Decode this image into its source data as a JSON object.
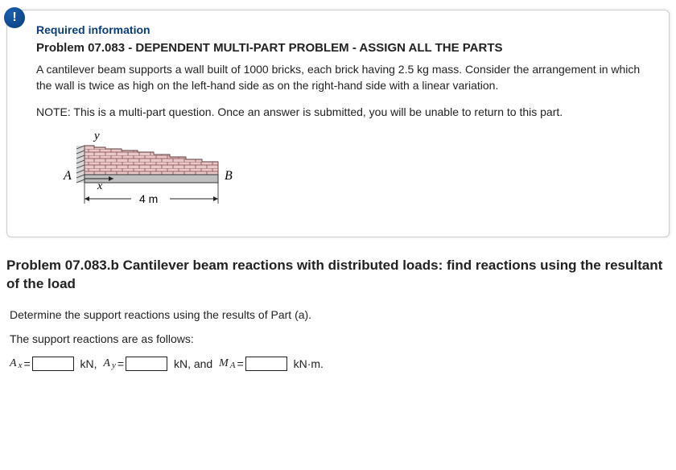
{
  "badge": "!",
  "info": {
    "required_label": "Required information",
    "header": "Problem 07.083 - DEPENDENT MULTI-PART PROBLEM - ASSIGN ALL THE PARTS",
    "description": "A cantilever beam supports a wall built of 1000 bricks, each brick having 2.5 kg mass. Consider the arrangement in which the wall is twice as high on the left-hand side as on the right-hand side with a linear variation.",
    "note": "NOTE: This is a multi-part question. Once an answer is submitted, you will be unable to return to this part.",
    "figure": {
      "y": "y",
      "x": "x",
      "A": "A",
      "B": "B",
      "length": "4 m"
    }
  },
  "sub": {
    "header": "Problem 07.083.b Cantilever beam reactions with distributed loads: find reactions using the resultant of the load",
    "instruction": "Determine the support reactions using the results of Part (a).",
    "lead": "The support reactions are as follows:",
    "ax_var": "A",
    "ax_sub": "x",
    "eq": " = ",
    "unit_kn": "kN, ",
    "ay_var": "A",
    "ay_sub": "y",
    "unit_kn2": "kN, and ",
    "ma_var": "M",
    "ma_sub": "A",
    "unit_knm": "kN·m."
  }
}
